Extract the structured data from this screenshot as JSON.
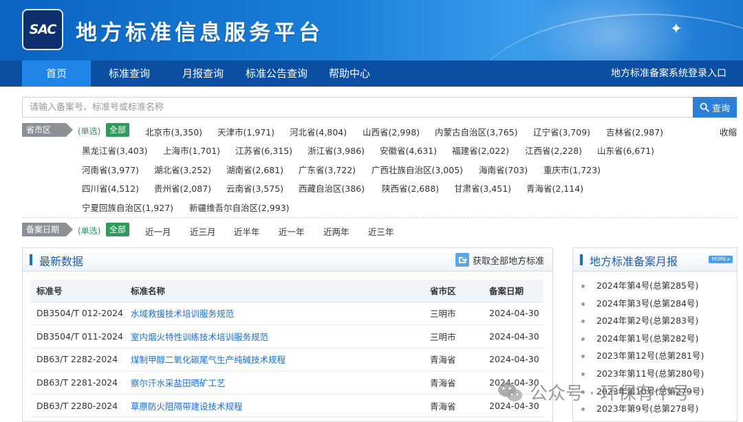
{
  "header": {
    "logo_text": "SAC",
    "site_title": "地方标准信息服务平台"
  },
  "nav": {
    "items": [
      "首页",
      "标准查询",
      "月报查询",
      "标准公告查询",
      "帮助中心"
    ],
    "login": "地方标准备案系统登录入口"
  },
  "search": {
    "placeholder": "请输入备案号、标准号或标准名称",
    "button": "查询"
  },
  "filters": {
    "region_label": "省市区",
    "single_label": "(单选)",
    "all_label": "全部",
    "collapse": "收缩",
    "regions": [
      "北京市(3,350)",
      "天津市(1,971)",
      "河北省(4,804)",
      "山西省(2,998)",
      "内蒙古自治区(3,765)",
      "辽宁省(3,709)",
      "吉林省(2,987)",
      "黑龙江省(3,403)",
      "上海市(1,701)",
      "江苏省(6,315)",
      "浙江省(3,986)",
      "安徽省(4,631)",
      "福建省(2,022)",
      "江西省(2,228)",
      "山东省(6,671)",
      "河南省(3,977)",
      "湖北省(3,252)",
      "湖南省(2,681)",
      "广东省(3,722)",
      "广西壮族自治区(3,005)",
      "海南省(703)",
      "重庆市(1,723)",
      "四川省(4,512)",
      "贵州省(2,087)",
      "云南省(3,575)",
      "西藏自治区(386)",
      "陕西省(2,688)",
      "甘肃省(3,451)",
      "青海省(2,114)",
      "宁夏回族自治区(1,927)",
      "新疆维吾尔自治区(2,993)"
    ],
    "date_label": "备案日期",
    "dates": [
      "近一月",
      "近三月",
      "近半年",
      "近一年",
      "近两年",
      "近三年"
    ]
  },
  "latest": {
    "title": "最新数据",
    "more": "获取全部地方标准",
    "columns": [
      "标准号",
      "标准名称",
      "省市区",
      "备案日期"
    ],
    "rows": [
      [
        "DB3504/T 012-2024",
        "水域救援技术培训服务规范",
        "三明市",
        "2024-04-30"
      ],
      [
        "DB3504/T 011-2024",
        "室内烟火特性训练技术培训服务规范",
        "三明市",
        "2024-04-30"
      ],
      [
        "DB63/T 2282-2024",
        "煤制甲醇二氧化碳尾气生产纯碱技术规程",
        "青海省",
        "2024-04-30"
      ],
      [
        "DB63/T 2281-2024",
        "察尔汗水采盐田晒矿工艺",
        "青海省",
        "2024-04-30"
      ],
      [
        "DB63/T 2280-2024",
        "草原防火阻隔带建设技术规程",
        "青海省",
        "2024-04-30"
      ]
    ]
  },
  "monthly": {
    "title": "地方标准备案月报",
    "more_badge": "MORE ▸",
    "items": [
      "2024年第4号(总第285号)",
      "2024年第3号(总第284号)",
      "2024年第2号(总第283号)",
      "2024年第1号(总第282号)",
      "2023年第12号(总第281号)",
      "2023年第11号(总第280号)",
      "2023年第10号(总第279号)",
      "2023年第9号(总第278号)"
    ]
  },
  "watermark": "公众号 · 环保有个号"
}
